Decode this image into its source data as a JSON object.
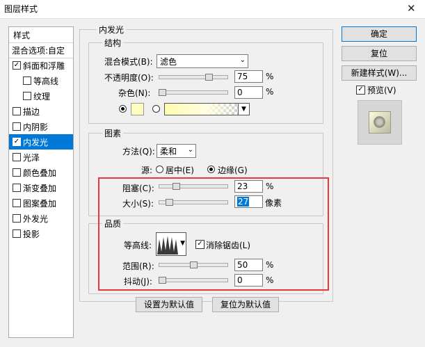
{
  "window": {
    "title": "图层样式",
    "close": "✕"
  },
  "styles_panel": {
    "header": "样式",
    "blend_options": "混合选项:自定",
    "items": [
      {
        "label": "斜面和浮雕",
        "checked": true,
        "indent": false,
        "selected": false
      },
      {
        "label": "等高线",
        "checked": false,
        "indent": true,
        "selected": false
      },
      {
        "label": "纹理",
        "checked": false,
        "indent": true,
        "selected": false
      },
      {
        "label": "描边",
        "checked": false,
        "indent": false,
        "selected": false
      },
      {
        "label": "内阴影",
        "checked": false,
        "indent": false,
        "selected": false
      },
      {
        "label": "内发光",
        "checked": true,
        "indent": false,
        "selected": true
      },
      {
        "label": "光泽",
        "checked": false,
        "indent": false,
        "selected": false
      },
      {
        "label": "颜色叠加",
        "checked": false,
        "indent": false,
        "selected": false
      },
      {
        "label": "渐变叠加",
        "checked": false,
        "indent": false,
        "selected": false
      },
      {
        "label": "图案叠加",
        "checked": false,
        "indent": false,
        "selected": false
      },
      {
        "label": "外发光",
        "checked": false,
        "indent": false,
        "selected": false
      },
      {
        "label": "投影",
        "checked": false,
        "indent": false,
        "selected": false
      }
    ]
  },
  "inner_glow": {
    "title": "内发光",
    "structure": {
      "title": "结构",
      "blend_mode_label": "混合模式(B):",
      "blend_mode_value": "滤色",
      "opacity_label": "不透明度(O):",
      "opacity_value": "75",
      "opacity_unit": "%",
      "opacity_level": 0.75,
      "noise_label": "杂色(N):",
      "noise_value": "0",
      "noise_unit": "%",
      "noise_level": 0.0,
      "glow_color": "#fffcc0"
    },
    "elements": {
      "title": "图素",
      "method_label": "方法(Q):",
      "method_value": "柔和",
      "source_label": "源:",
      "source_center": "居中(E)",
      "source_edge": "边缘(G)",
      "choke_label": "阻塞(C):",
      "choke_value": "23",
      "choke_unit": "%",
      "choke_level": 0.23,
      "size_label": "大小(S):",
      "size_value": "27",
      "size_unit": "像素",
      "size_level": 0.108
    },
    "quality": {
      "title": "品质",
      "contour_label": "等高线:",
      "antialias_label": "消除锯齿(L)",
      "range_label": "范围(R):",
      "range_value": "50",
      "range_unit": "%",
      "range_level": 0.5,
      "jitter_label": "抖动(J):",
      "jitter_value": "0",
      "jitter_unit": "%",
      "jitter_level": 0.0
    },
    "set_default": "设置为默认值",
    "reset_default": "复位为默认值"
  },
  "actions": {
    "ok": "确定",
    "reset": "复位",
    "new_style": "新建样式(W)...",
    "preview": "预览(V)"
  },
  "colors": {
    "accent": "#0078d7",
    "highlight_box": "#e8373d"
  }
}
